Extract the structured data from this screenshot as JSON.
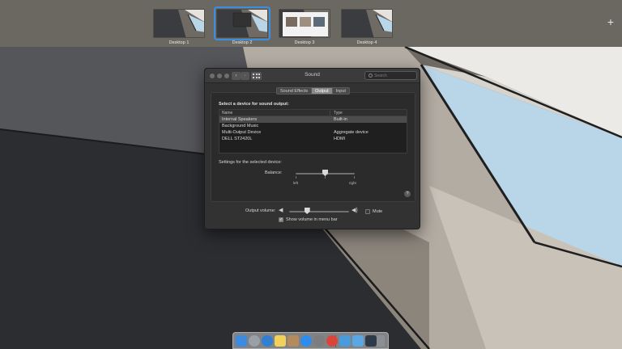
{
  "spaces": {
    "items": [
      {
        "label": "Desktop 1"
      },
      {
        "label": "Desktop 2"
      },
      {
        "label": "Desktop 3"
      },
      {
        "label": "Desktop 4"
      }
    ],
    "active_index": 1,
    "add_glyph": "+"
  },
  "window": {
    "title": "Sound",
    "search_placeholder": "Search",
    "nav_back": "‹",
    "nav_forward": "›",
    "tabs": [
      {
        "label": "Sound Effects"
      },
      {
        "label": "Output",
        "selected": true
      },
      {
        "label": "Input"
      }
    ],
    "output": {
      "heading": "Select a device for sound output:",
      "columns": [
        "Name",
        "Type"
      ],
      "devices": [
        {
          "name": "Internal Speakers",
          "type": "Built-in",
          "selected": true
        },
        {
          "name": "Background Music",
          "type": ""
        },
        {
          "name": "Multi-Output Device",
          "type": "Aggregate device"
        },
        {
          "name": "DELL ST2420L",
          "type": "HDMI"
        }
      ],
      "settings_label": "Settings for the selected device:",
      "balance_label": "Balance:",
      "balance_left": "left",
      "balance_right": "right",
      "balance_value": 0.5,
      "help_glyph": "?"
    },
    "volume": {
      "label": "Output volume:",
      "value": 0.3,
      "mute_label": "Mute",
      "mute_checked": false,
      "menu_bar_label": "Show volume in menu bar",
      "menu_bar_checked": true,
      "check_glyph": "✓"
    }
  },
  "dock": {
    "icons": [
      {
        "name": "finder-icon",
        "color": "#3d8be0"
      },
      {
        "name": "launchpad-icon",
        "color": "#9aa0a8"
      },
      {
        "name": "safari-icon",
        "color": "#2f7fd4"
      },
      {
        "name": "notes-icon",
        "color": "#f2d15a"
      },
      {
        "name": "contacts-icon",
        "color": "#b58a5c"
      },
      {
        "name": "app-store-icon",
        "color": "#2d8cf0"
      },
      {
        "name": "system-preferences-icon",
        "color": "#7d7d7d"
      },
      {
        "name": "chrome-icon",
        "color": "#d9453b"
      },
      {
        "name": "applications-folder-icon",
        "color": "#4a9bdc"
      },
      {
        "name": "documents-folder-icon",
        "color": "#5aa7e6"
      },
      {
        "name": "monitor-icon",
        "color": "#2d3a4a"
      },
      {
        "name": "trash-icon",
        "color": "#8c9096"
      }
    ]
  }
}
